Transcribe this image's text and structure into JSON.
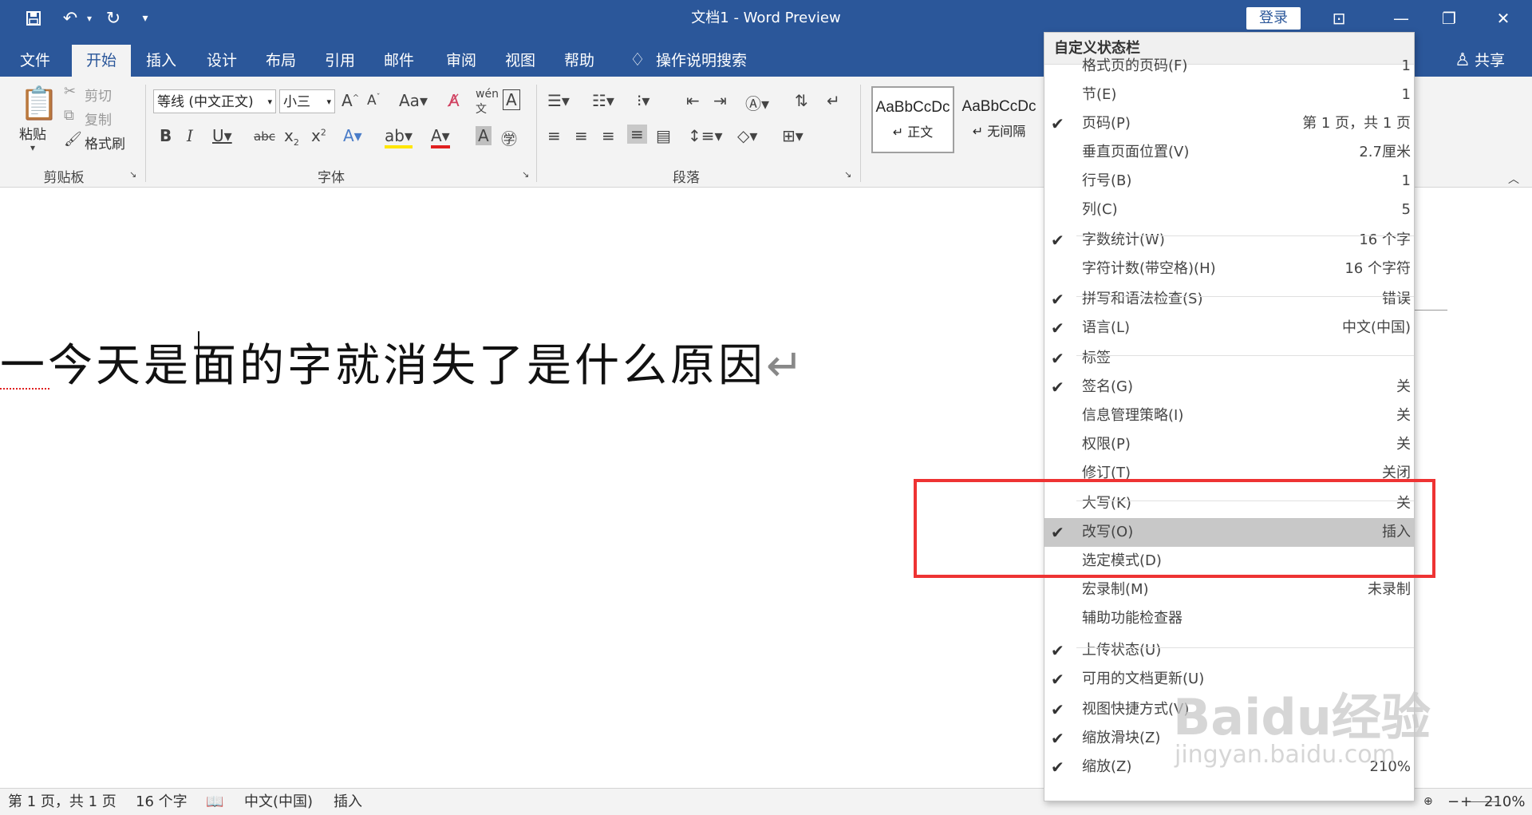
{
  "window": {
    "title": "文档1  -  Word Preview",
    "login": "登录"
  },
  "qat": {
    "save_icon": "save-icon",
    "undo_icon": "undo-icon",
    "redo_icon": "redo-icon",
    "customize_icon": "customize-qat-icon"
  },
  "tabs": [
    "文件",
    "开始",
    "插入",
    "设计",
    "布局",
    "引用",
    "邮件",
    "审阅",
    "视图",
    "帮助"
  ],
  "search": {
    "label": "操作说明搜索"
  },
  "share": {
    "label": "共享"
  },
  "ribbon": {
    "clipboard": {
      "label": "剪贴板",
      "paste": "粘贴",
      "cut": "剪切",
      "copy": "复制",
      "format_painter": "格式刷"
    },
    "font": {
      "label": "字体",
      "font_name": "等线 (中文正文)",
      "font_size": "小三"
    },
    "paragraph": {
      "label": "段落"
    },
    "styles": {
      "items": [
        {
          "preview": "AaBbCcDc",
          "name": "↵ 正文"
        },
        {
          "preview": "AaBbCcDc",
          "name": "↵ 无间隔"
        }
      ]
    }
  },
  "document": {
    "text": "一今天是面的字就消失了是什么原因",
    "para_mark": "↵"
  },
  "statusbar": {
    "page": "第 1 页，共 1 页",
    "words": "16 个字",
    "language": "中文(中国)",
    "mode": "插入",
    "zoom_minus": "−",
    "zoom_plus": "+",
    "zoom": "210%",
    "zoom_level_percent": 210
  },
  "menu": {
    "title": "自定义状态栏",
    "items": [
      {
        "label": "格式页的页码(F)",
        "value": "1",
        "checked": false
      },
      {
        "label": "节(E)",
        "value": "1",
        "checked": false
      },
      {
        "label": "页码(P)",
        "value": "第 1 页，共 1 页",
        "checked": true
      },
      {
        "label": "垂直页面位置(V)",
        "value": "2.7厘米",
        "checked": false
      },
      {
        "label": "行号(B)",
        "value": "1",
        "checked": false
      },
      {
        "label": "列(C)",
        "value": "5",
        "checked": false
      },
      {
        "label": "字数统计(W)",
        "value": "16 个字",
        "checked": true
      },
      {
        "label": "字符计数(带空格)(H)",
        "value": "16 个字符",
        "checked": false
      },
      {
        "label": "拼写和语法检查(S)",
        "value": "错误",
        "checked": true
      },
      {
        "label": "语言(L)",
        "value": "中文(中国)",
        "checked": true
      },
      {
        "label": "标签",
        "value": "",
        "checked": true
      },
      {
        "label": "签名(G)",
        "value": "关",
        "checked": true
      },
      {
        "label": "信息管理策略(I)",
        "value": "关",
        "checked": false
      },
      {
        "label": "权限(P)",
        "value": "关",
        "checked": false
      },
      {
        "label": "修订(T)",
        "value": "关闭",
        "checked": false
      },
      {
        "label": "大写(K)",
        "value": "关",
        "checked": false
      },
      {
        "label": "改写(O)",
        "value": "插入",
        "checked": true,
        "highlighted": true
      },
      {
        "label": "选定模式(D)",
        "value": "",
        "checked": false
      },
      {
        "label": "宏录制(M)",
        "value": "未录制",
        "checked": false
      },
      {
        "label": "辅助功能检查器",
        "value": "",
        "checked": false
      },
      {
        "label": "上传状态(U)",
        "value": "",
        "checked": true
      },
      {
        "label": "可用的文档更新(U)",
        "value": "",
        "checked": true
      },
      {
        "label": "视图快捷方式(V)",
        "value": "",
        "checked": true
      },
      {
        "label": "缩放滑块(Z)",
        "value": "",
        "checked": true
      },
      {
        "label": "缩放(Z)",
        "value": "210%",
        "checked": true
      }
    ]
  },
  "watermark": {
    "brand": "Baidu经验",
    "url": "jingyan.baidu.com"
  },
  "colors": {
    "brand": "#2b579a",
    "highlight": "#ee3333"
  }
}
